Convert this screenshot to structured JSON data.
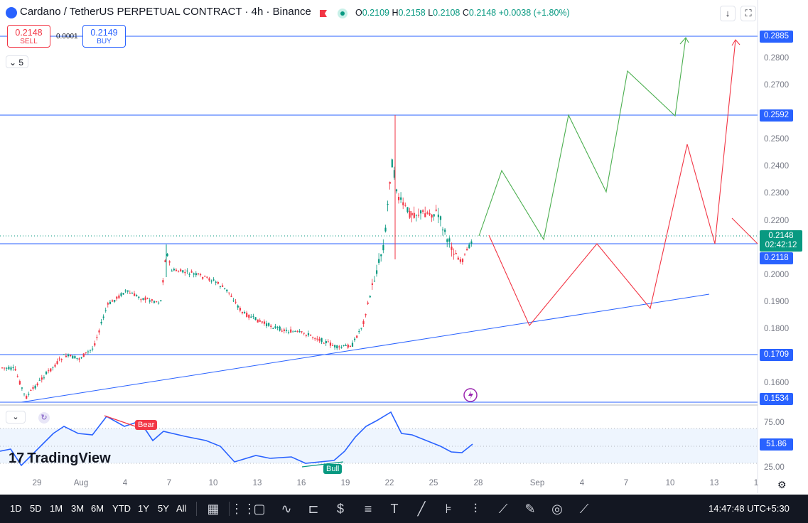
{
  "header": {
    "title": "Cardano / TetherUS PERPETUAL CONTRACT · 4h · Binance",
    "ohlc": {
      "o_label": "O",
      "o": "0.2109",
      "h_label": "H",
      "h": "0.2158",
      "l_label": "L",
      "l": "0.2108",
      "c_label": "C",
      "c": "0.2148",
      "change": "+0.0038 (+1.80%)"
    },
    "collapse_count": "5"
  },
  "trade": {
    "sell_price": "0.2148",
    "sell_label": "SELL",
    "spread": "0.0001",
    "buy_price": "0.2149",
    "buy_label": "BUY"
  },
  "price_axis": {
    "ticks": [
      "0.2800",
      "0.2700",
      "0.2500",
      "0.2400",
      "0.2300",
      "0.2200",
      "0.2000",
      "0.1900",
      "0.1800",
      "0.1600"
    ],
    "levels": [
      "0.2885",
      "0.2592",
      "0.2118",
      "0.1709",
      "0.1534"
    ],
    "current_price": "0.2148",
    "countdown": "02:42:12"
  },
  "indicator": {
    "ticks": [
      "75.00",
      "25.00"
    ],
    "value": "51.86",
    "bear_label": "Bear",
    "bull_label": "Bull"
  },
  "time_axis": [
    "29",
    "Aug",
    "4",
    "7",
    "10",
    "13",
    "16",
    "19",
    "22",
    "25",
    "28",
    "Sep",
    "4",
    "7",
    "10",
    "13",
    "1"
  ],
  "branding": {
    "logo": "TradingView"
  },
  "bottom_bar": {
    "ranges": [
      "1D",
      "5D",
      "1M",
      "3M",
      "6M",
      "YTD",
      "1Y",
      "5Y",
      "All"
    ],
    "clock": "14:47:48 UTC+5:30"
  },
  "colors": {
    "up": "#089981",
    "down": "#f23645",
    "level_line": "#2962ff",
    "rsi_line": "#2962ff",
    "projection_bull": "#4caf50",
    "projection_bear": "#f23645"
  },
  "icons": {
    "sell_flag": "flag-icon",
    "visibility": "eye-icon",
    "download": "down-arrow-icon",
    "fullscreen": "fullscreen-icon",
    "settings": "gear-icon"
  }
}
